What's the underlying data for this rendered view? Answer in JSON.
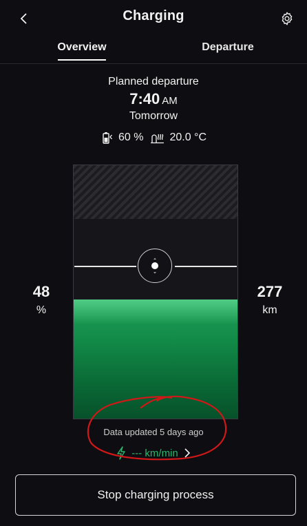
{
  "header": {
    "title": "Charging",
    "back_icon": "chevron-left-icon",
    "settings_icon": "gear-icon"
  },
  "tabs": [
    {
      "label": "Overview",
      "active": true
    },
    {
      "label": "Departure",
      "active": false
    }
  ],
  "departure": {
    "label": "Planned departure",
    "time": "7:40",
    "ampm": "AM",
    "day": "Tomorrow"
  },
  "stats": {
    "target_soc": "60 %",
    "climate_temp": "20.0 °C",
    "battery_icon": "battery-charging-icon",
    "climate_icon": "climate-heat-icon"
  },
  "battery": {
    "soc_value": "48",
    "soc_unit": "%",
    "range_value": "277",
    "range_unit": "km",
    "fill_level": 0.48
  },
  "status": {
    "updated_text": "Data updated 5 days ago"
  },
  "rate": {
    "value": "--- km/min",
    "icon": "lightning-icon"
  },
  "actions": {
    "stop_label": "Stop charging process"
  },
  "colors": {
    "accent_green": "#1fa05a",
    "background": "#0e0e12",
    "annotation_red": "#d01818"
  }
}
